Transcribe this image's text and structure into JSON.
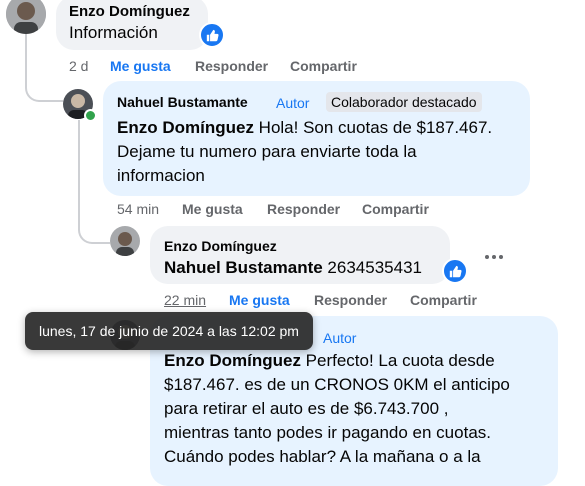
{
  "colors": {
    "accent": "#1877f2",
    "bubble": "#f0f2f5",
    "bubble_highlight": "#e7f3ff",
    "online": "#31a24c"
  },
  "comment1": {
    "author": "Enzo Domínguez",
    "text": "Información",
    "reaction_icon": "like-icon",
    "time": "2 d",
    "like": "Me gusta",
    "reply": "Responder",
    "share": "Compartir"
  },
  "comment2": {
    "author": "Nahuel Bustamante",
    "role_badge": "Autor",
    "top_badge": "Colaborador destacado",
    "mention": "Enzo Domínguez",
    "text_line1": " Hola! Son cuotas de $187.467.",
    "text_line2": "Dejame tu numero para enviarte toda la",
    "text_line3": "informacion",
    "time": "54 min",
    "like": "Me gusta",
    "reply": "Responder",
    "share": "Compartir"
  },
  "comment3": {
    "author": "Enzo Domínguez",
    "mention": "Nahuel Bustamante",
    "text": " 2634535431",
    "reaction_icon": "like-icon",
    "time": "22 min",
    "like": "Me gusta",
    "reply": "Responder",
    "share": "Compartir"
  },
  "comment4": {
    "role_badge": "Autor",
    "mention": "Enzo Domínguez",
    "text_line1": " Perfecto! La cuota desde",
    "text_line2": "$187.467. es de un CRONOS 0KM el anticipo",
    "text_line3": "para retirar el auto es de $6.743.700 ,",
    "text_line4": "mientras tanto podes ir pagando en cuotas.",
    "text_line5": "Cuándo podes hablar? A la mañana o a la"
  },
  "tooltip": {
    "text": "lunes, 17 de junio de 2024 a las 12:02 pm"
  }
}
